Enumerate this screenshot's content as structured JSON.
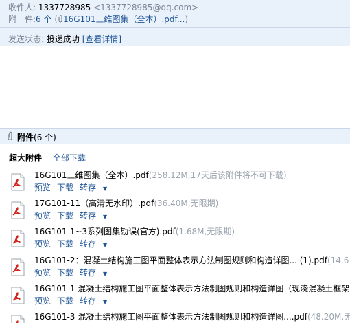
{
  "header": {
    "to_label": "收件人:",
    "to_name": "1337728985",
    "to_addr": "<1337728985@qq.com>",
    "att_label": "附　件:",
    "att_count": "6 个",
    "att_open": "(",
    "att_link": "16G101三维图集（全本）.pdf...",
    "att_close": ")",
    "status_label": "发送状态:",
    "status_value": "投递成功",
    "status_link": "[查看详情]"
  },
  "attachments": {
    "title": "附件",
    "count": "(6 个)",
    "big_label": "超大附件",
    "download_all": "全部下载",
    "actions": {
      "preview": "预览",
      "download": "下载",
      "forward": "转存"
    },
    "items": [
      {
        "name": "16G101三维图集（全本）.pdf",
        "meta": "(258.12M,17天后该附件将不可下载)"
      },
      {
        "name": "17G101-11（高清无水印）.pdf",
        "meta": "(36.40M,无限期)"
      },
      {
        "name": "16G101-1~3系列图集勘误(官方).pdf",
        "meta": "(1.68M,无限期)"
      },
      {
        "name": "16G101-2：混凝土结构施工图平面整体表示方法制图规则和构造详图... (1).pdf",
        "meta": "(14.6"
      },
      {
        "name": "16G101-1 混凝土结构施工图平面整体表示方法制图规则和构造详图（现浇混凝土框架",
        "meta": ""
      },
      {
        "name": "16G101-3 混凝土结构施工图平面整体表示方法制图规则和构造详图....pdf",
        "meta": "(48.20M,无"
      }
    ]
  }
}
